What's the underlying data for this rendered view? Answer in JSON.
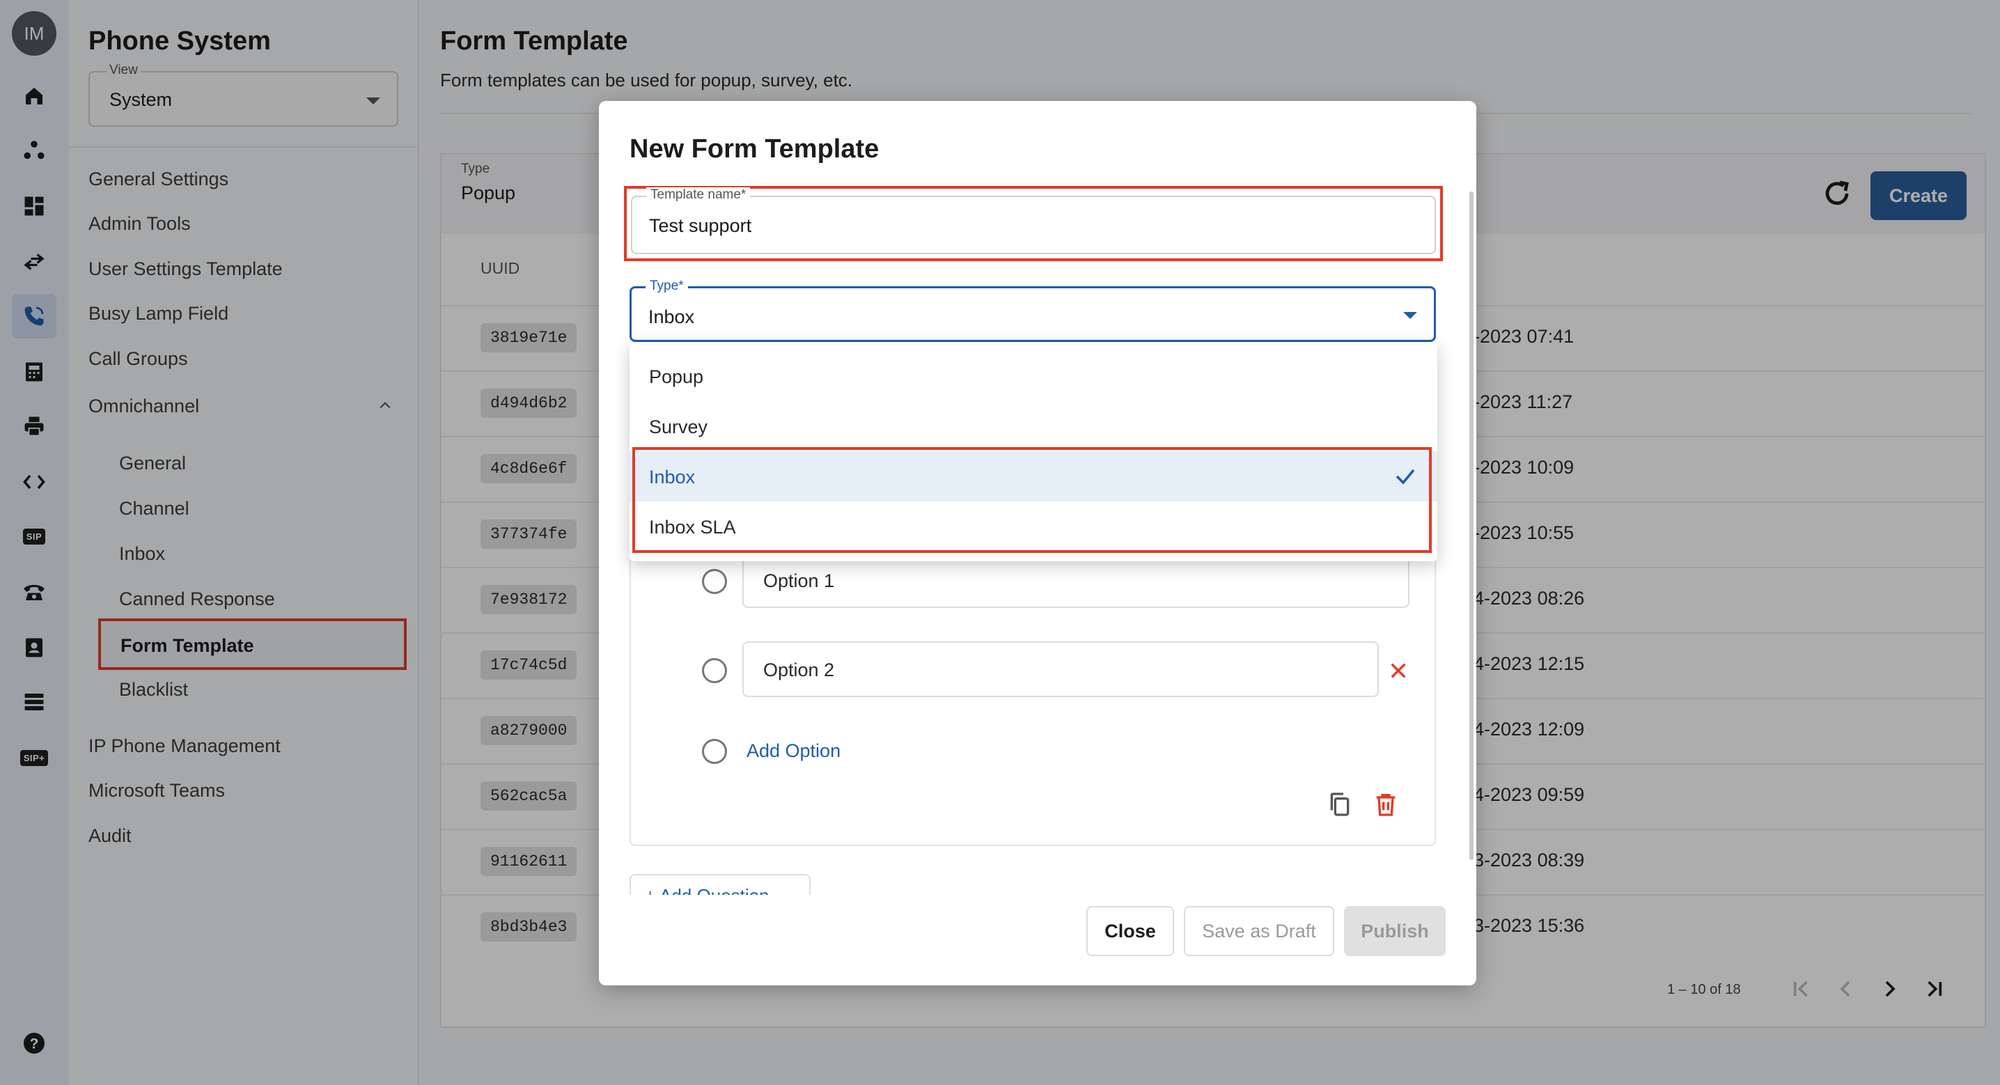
{
  "rail": {
    "avatar_initials": "IM",
    "icons": [
      "home-icon",
      "org-icon",
      "dashboard-icon",
      "transfer-icon",
      "phone-icon",
      "fax-icon",
      "printer-icon",
      "code-icon",
      "sip-icon",
      "telephone-icon",
      "contact-icon",
      "list-icon",
      "sip-plus-icon",
      "help-icon"
    ],
    "sip_label": "SIP",
    "sip_plus_label": "SIP+",
    "help_label": "?"
  },
  "sidebar": {
    "title": "Phone System",
    "view_label": "View",
    "view_value": "System",
    "items": [
      "General Settings",
      "Admin Tools",
      "User Settings Template",
      "Busy Lamp Field",
      "Call Groups",
      "Omnichannel"
    ],
    "omnichannel_items": [
      "General",
      "Channel",
      "Inbox",
      "Canned Response",
      "Form Template",
      "Blacklist"
    ],
    "bottom_items": [
      "IP Phone Management",
      "Microsoft Teams",
      "Audit"
    ]
  },
  "main": {
    "title": "Form Template",
    "description": "Form templates can be used for popup, survey, etc.",
    "filter_label": "Type",
    "filter_value": "Popup",
    "create_label": "Create",
    "column_uuid": "UUID",
    "rows": [
      {
        "uuid": "3819e71e",
        "date": "-2023 07:41"
      },
      {
        "uuid": "d494d6b2",
        "date": "-2023 11:27"
      },
      {
        "uuid": "4c8d6e6f",
        "date": "-2023 10:09"
      },
      {
        "uuid": "377374fe",
        "date": "-2023 10:55"
      },
      {
        "uuid": "7e938172",
        "date": "4-2023 08:26"
      },
      {
        "uuid": "17c74c5d",
        "date": "4-2023 12:15"
      },
      {
        "uuid": "a8279000",
        "date": "4-2023 12:09"
      },
      {
        "uuid": "562cac5a",
        "date": "4-2023 09:59"
      },
      {
        "uuid": "91162611",
        "date": "3-2023 08:39"
      },
      {
        "uuid": "8bd3b4e3",
        "date": "3-2023 15:36"
      }
    ],
    "pagination": "1 – 10 of 18"
  },
  "modal": {
    "title": "New Form Template",
    "name_label": "Template name*",
    "name_value": "Test support",
    "type_label": "Type*",
    "type_value": "Inbox",
    "options": [
      "Option 1",
      "Option 2"
    ],
    "add_option_label": "Add Option",
    "add_question_label": "+ Add Question",
    "close_label": "Close",
    "draft_label": "Save as Draft",
    "publish_label": "Publish"
  },
  "dropdown": {
    "items": [
      "Popup",
      "Survey",
      "Inbox",
      "Inbox SLA"
    ],
    "selected": "Inbox"
  },
  "colors": {
    "accent": "#2b5f9c",
    "highlight_border": "#e03c26",
    "link": "#1f5ea8"
  }
}
